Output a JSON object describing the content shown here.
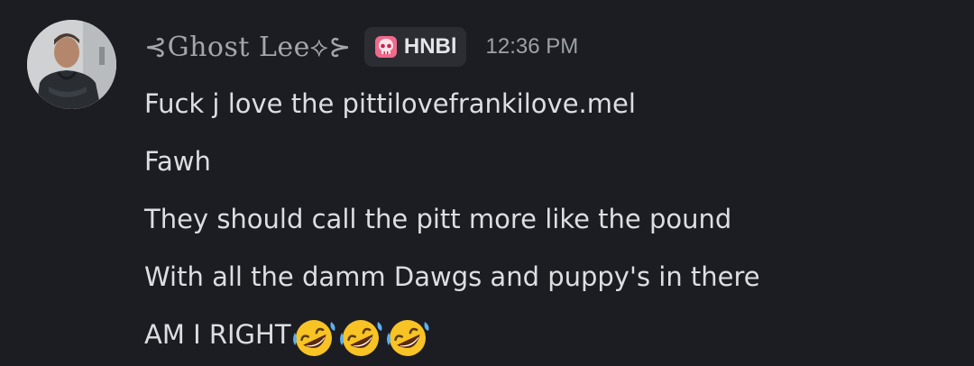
{
  "message": {
    "author": "⊰Ghost Lee⟡⊱",
    "role_tag": {
      "label": "HNBl",
      "icon": "skull-icon",
      "icon_color": "#f06a8b"
    },
    "timestamp": "12:36 PM",
    "lines": [
      "Fuck j love the pittilovefrankilove.mel",
      "Fawh",
      "They should call the pitt more like the pound",
      "With all the damm Dawgs and puppy's in there",
      "AM I RIGHT"
    ],
    "trailing_emojis": [
      "rolling-on-floor-laughing-emoji",
      "rolling-on-floor-laughing-emoji",
      "rolling-on-floor-laughing-emoji"
    ]
  }
}
